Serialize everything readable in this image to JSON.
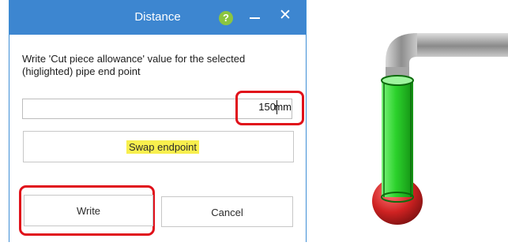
{
  "window": {
    "title": "Distance",
    "help_glyph": "?",
    "close_glyph": "✕"
  },
  "instructions": "Write 'Cut piece allowance' value for the selected (higlighted) pipe end point",
  "distance_field": {
    "value": "150",
    "unit": "mm"
  },
  "buttons": {
    "swap_label": "Swap endpoint",
    "write_label": "Write",
    "cancel_label": "Cancel"
  },
  "icons": {
    "help": "help-icon",
    "minimize": "minimize-icon",
    "close": "close-icon"
  },
  "colors": {
    "titlebar": "#3d86d0",
    "highlight_outline": "#e0101a",
    "swap_highlight": "#f8ef4e",
    "selected_pipe": "#2ec92e",
    "endpoint": "#c81f1f"
  }
}
